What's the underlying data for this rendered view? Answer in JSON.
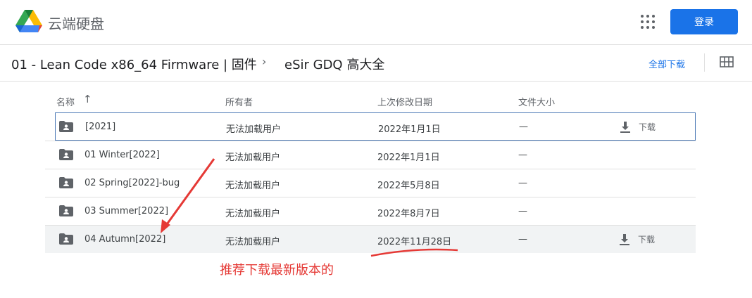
{
  "app": {
    "brand": "云端硬盘",
    "login_label": "登录"
  },
  "breadcrumb": {
    "parent": "01 - Lean Code x86_64 Firmware | 固件",
    "separator": "›",
    "current": "eSir GDQ 高大全"
  },
  "toolbar": {
    "download_all": "全部下载"
  },
  "table": {
    "headers": {
      "name": "名称",
      "sort": "↑",
      "owner": "所有者",
      "modified": "上次修改日期",
      "size": "文件大小"
    },
    "rows": [
      {
        "name": "[2021]",
        "owner": "无法加载用户",
        "modified": "2022年1月1日",
        "size": "—",
        "download": "下载"
      },
      {
        "name": "01 Winter[2022]",
        "owner": "无法加载用户",
        "modified": "2022年1月1日",
        "size": "—"
      },
      {
        "name": "02 Spring[2022]-bug",
        "owner": "无法加载用户",
        "modified": "2022年5月8日",
        "size": "—"
      },
      {
        "name": "03 Summer[2022]",
        "owner": "无法加载用户",
        "modified": "2022年8月7日",
        "size": "—"
      },
      {
        "name": "04 Autumn[2022]",
        "owner": "无法加载用户",
        "modified": "2022年11月28日",
        "size": "—",
        "download": "下载"
      }
    ]
  },
  "annotation": {
    "text": "推荐下载最新版本的",
    "color": "#e53935"
  }
}
